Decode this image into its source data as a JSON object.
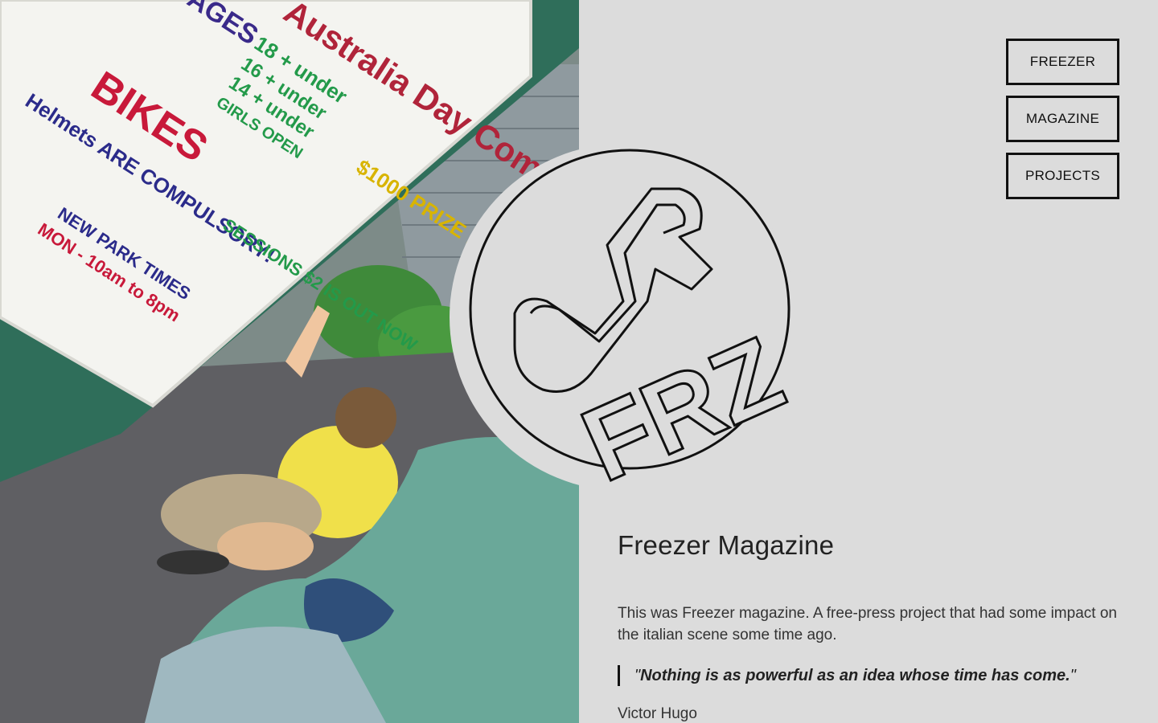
{
  "nav": {
    "items": [
      {
        "label": "FREEZER"
      },
      {
        "label": "MAGAZINE"
      },
      {
        "label": "PROJECTS"
      }
    ]
  },
  "logo": {
    "icon": "ferz-logo-icon",
    "letters": "FRZ"
  },
  "photo": {
    "icon": "skatepark-whiteboard-photo",
    "board": {
      "headline": "Australia Day Comp",
      "ages": "AGES",
      "age1": "18 + under",
      "age2": "16 + under",
      "age3": "14 + under",
      "age4": "GIRLS OPEN",
      "prize": "$1000 PRIZE POOL",
      "bikes": "BIKES",
      "helmets": "Helmets ARE COMPULSORY!",
      "sessions": "SESSIONS $2 IS OUT NOW",
      "new_park": "NEW PARK TIMES",
      "hours": "MON - 10am to 8pm"
    }
  },
  "main": {
    "title": "Freezer Magazine",
    "description": "This was Freezer magazine. A free-press project that had some impact on the italian scene some time ago.",
    "quote_open": "\"",
    "quote": "Nothing is as powerful as an idea whose time has come.",
    "quote_close": "\"",
    "author": "Victor Hugo"
  }
}
